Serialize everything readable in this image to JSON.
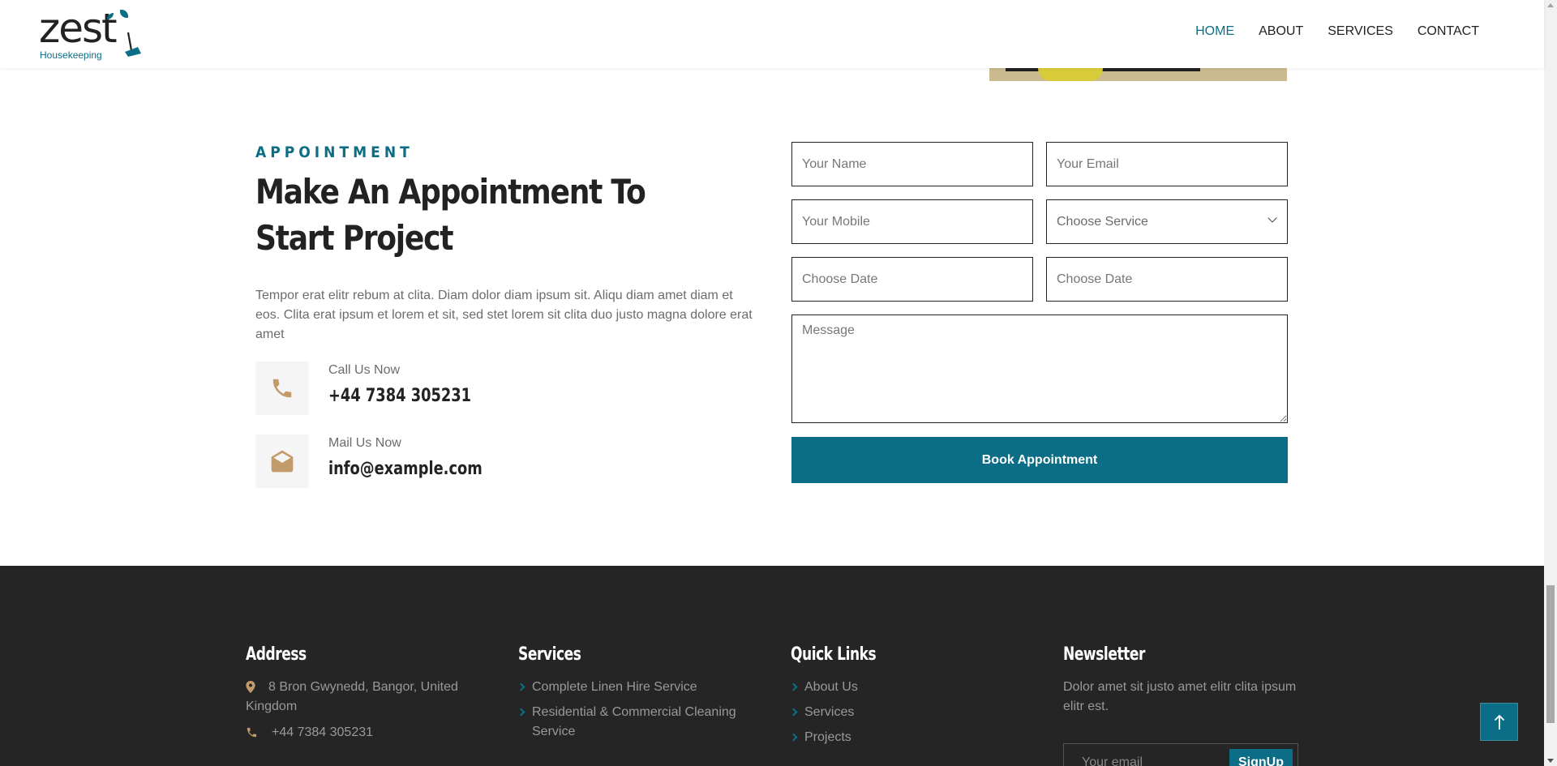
{
  "brand": {
    "logo_word": "zest",
    "logo_sub": "Housekeeping"
  },
  "nav": {
    "items": [
      "HOME",
      "ABOUT",
      "SERVICES",
      "CONTACT"
    ],
    "active": "HOME"
  },
  "appointment": {
    "eyebrow": "APPOINTMENT",
    "title": "Make An Appointment To Start Project",
    "intro": "Tempor erat elitr rebum at clita. Diam dolor diam ipsum sit. Aliqu diam amet diam et eos. Clita erat ipsum et lorem et sit, sed stet lorem sit clita duo justo magna dolore erat amet",
    "call_label": "Call Us Now",
    "call_value": "+44 7384 305231",
    "mail_label": "Mail Us Now",
    "mail_value": "info@example.com"
  },
  "form": {
    "name_placeholder": "Your Name",
    "email_placeholder": "Your Email",
    "mobile_placeholder": "Your Mobile",
    "service_selected": "Choose Service",
    "date1_placeholder": "Choose Date",
    "date2_placeholder": "Choose Date",
    "message_placeholder": "Message",
    "submit_label": "Book Appointment"
  },
  "footer": {
    "address_head": "Address",
    "address_line": "8 Bron Gwynedd, Bangor, United Kingdom",
    "address_phone": "+44 7384 305231",
    "services_head": "Services",
    "services": [
      "Complete Linen Hire Service",
      "Residential & Commercial Cleaning Service"
    ],
    "links_head": "Quick Links",
    "links": [
      "About Us",
      "Services",
      "Projects"
    ],
    "newsletter_head": "Newsletter",
    "newsletter_text": "Dolor amet sit justo amet elitr clita ipsum elitr est.",
    "newsletter_placeholder": "Your email",
    "signup_label": "SignUp"
  },
  "colors": {
    "accent": "#0b6e86",
    "icon_orange": "#c39a6a",
    "footer_bg": "#252525"
  },
  "icons": [
    "phone-icon",
    "envelope-open-icon",
    "map-marker-icon",
    "chevron-right-icon",
    "arrow-up-icon"
  ]
}
